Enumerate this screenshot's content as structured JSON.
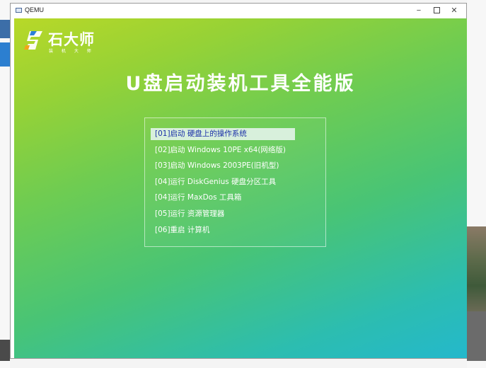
{
  "window": {
    "title": "QEMU",
    "controls": {
      "minimize": "−",
      "close": "✕"
    }
  },
  "screen": {
    "logo": {
      "name": "石大师",
      "subtitle": "装 机 大 师"
    },
    "headline": "U盘启动装机工具全能版",
    "menu": {
      "selected_index": 0,
      "items": [
        "[01]启动 硬盘上的操作系统",
        "[02]启动 Windows 10PE x64(网络版)",
        "[03]启动 Windows 2003PE(旧机型)",
        "[04]运行 DiskGenius 硬盘分区工具",
        "[04]运行 MaxDos 工具箱",
        "[05]运行 资源管理器",
        "[06]重启 计算机"
      ]
    }
  },
  "colors": {
    "gradient_start": "#b8d828",
    "gradient_end": "#24b8cc",
    "selected_bg": "#d8f0dc",
    "selected_text": "#1a2fa8"
  }
}
